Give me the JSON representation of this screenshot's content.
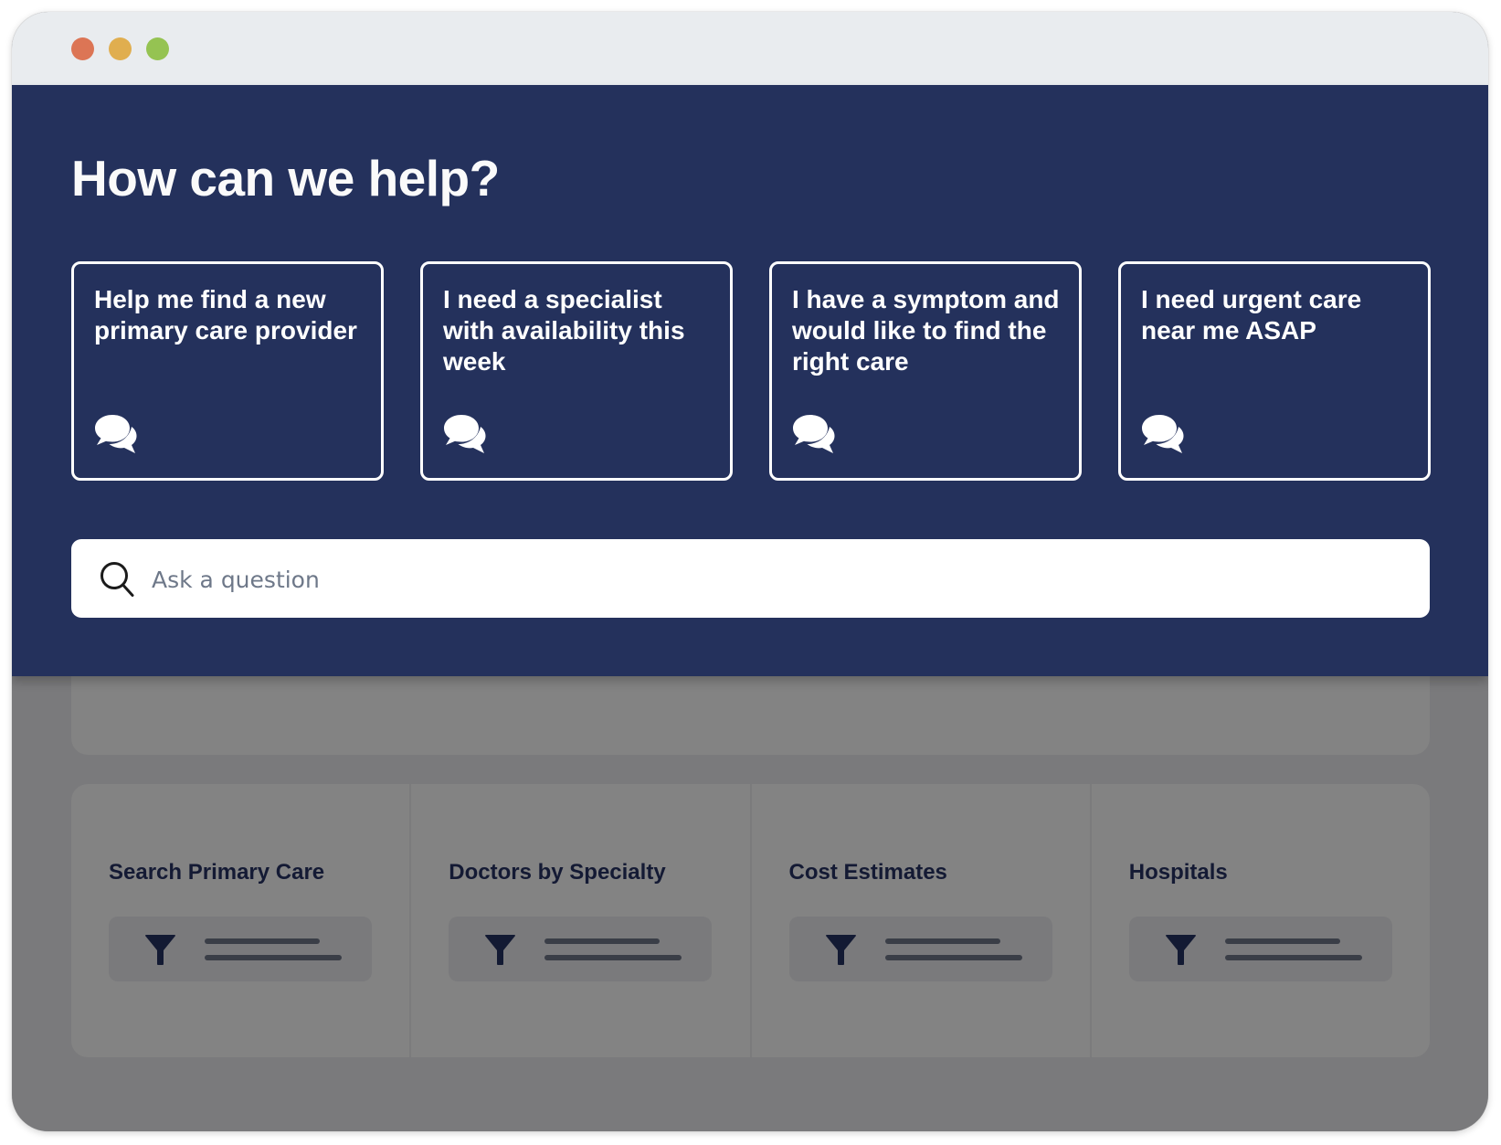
{
  "window": {
    "controls": [
      {
        "name": "close",
        "color": "#dc7555"
      },
      {
        "name": "minimize",
        "color": "#e0ae4f"
      },
      {
        "name": "maximize",
        "color": "#95c352"
      }
    ]
  },
  "hero": {
    "title": "How can we help?",
    "cards": [
      {
        "text": "Help me find a new primary care provider",
        "icon": "comments-icon"
      },
      {
        "text": "I need a specialist with availability this week",
        "icon": "comments-icon"
      },
      {
        "text": "I have a symptom and would like to find the right care",
        "icon": "comments-icon"
      },
      {
        "text": "I need urgent care near me ASAP",
        "icon": "comments-icon"
      }
    ],
    "search": {
      "placeholder": "Ask a question",
      "value": "",
      "icon": "search-icon"
    }
  },
  "tools": [
    {
      "label": "Search Primary Care",
      "icon": "filter-icon"
    },
    {
      "label": "Doctors by Specialty",
      "icon": "filter-icon"
    },
    {
      "label": "Cost Estimates",
      "icon": "filter-icon"
    },
    {
      "label": "Hospitals",
      "icon": "filter-icon"
    }
  ],
  "colors": {
    "hero_bg": "#24315c",
    "overlay_bg": "#7a7a7c",
    "panel_bg": "#838383",
    "tool_label": "#141a34"
  }
}
